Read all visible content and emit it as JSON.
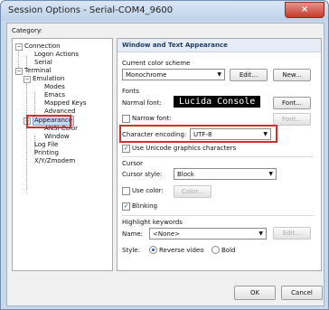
{
  "window": {
    "title": "Session Options - Serial-COM4_9600",
    "close_glyph": "×"
  },
  "category_label": "Category:",
  "tree": {
    "connection": "Connection",
    "logon_actions": "Logon Actions",
    "serial": "Serial",
    "terminal": "Terminal",
    "emulation": "Emulation",
    "modes": "Modes",
    "emacs": "Emacs",
    "mapped_keys": "Mapped Keys",
    "advanced": "Advanced",
    "appearance": "Appearance",
    "ansi_color": "ANSI Color",
    "window": "Window",
    "log_file": "Log File",
    "printing": "Printing",
    "xyz_modem": "X/Y/Zmodem",
    "expander_minus": "−"
  },
  "panel": {
    "header": "Window and Text Appearance",
    "color_scheme_label": "Current color scheme",
    "color_scheme_value": "Monochrome",
    "edit_button": "Edit...",
    "new_button": "New...",
    "fonts_label": "Fonts",
    "normal_font_label": "Normal font:",
    "normal_font_sample": "Lucida Console",
    "font_button": "Font...",
    "narrow_font_label": "Narrow font:",
    "narrow_font_button": "Font...",
    "char_encoding_label": "Character encoding:",
    "char_encoding_value": "UTF-8",
    "unicode_graphics_label": "Use Unicode graphics characters",
    "cursor_label": "Cursor",
    "cursor_style_label": "Cursor style:",
    "cursor_style_value": "Block",
    "use_color_label": "Use color:",
    "color_button": "Color...",
    "blinking_label": "Blinking",
    "highlight_label": "Highlight keywords",
    "name_label": "Name:",
    "name_value": "<None>",
    "highlight_edit_button": "Edit...",
    "style_label": "Style:",
    "reverse_video_label": "Reverse video",
    "bold_label": "Bold"
  },
  "footer": {
    "ok": "OK",
    "cancel": "Cancel"
  },
  "checks": {
    "narrow_font": false,
    "unicode_graphics": true,
    "use_color": false,
    "blinking": true
  },
  "colors": {
    "highlight_box": "#d32f2f",
    "selection": "#c7ddf4"
  }
}
